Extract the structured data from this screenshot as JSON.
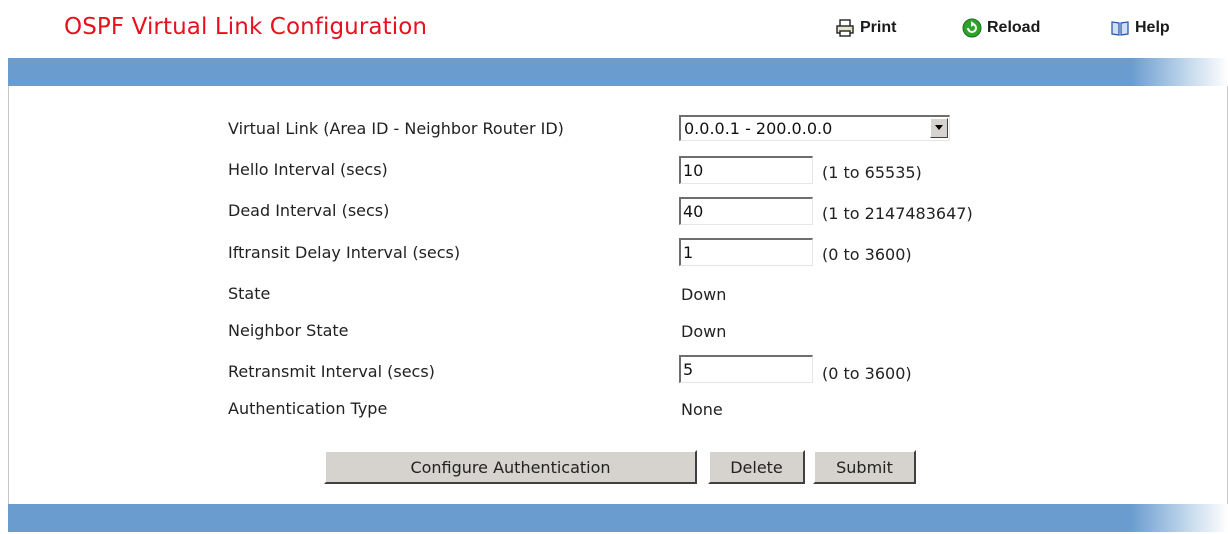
{
  "page": {
    "title": "OSPF Virtual Link Configuration"
  },
  "toolbar": {
    "print": "Print",
    "reload": "Reload",
    "help": "Help"
  },
  "colors": {
    "title": "#e8101f",
    "band": "#6a9ccf"
  },
  "form": {
    "virtual_link": {
      "label": "Virtual Link (Area ID - Neighbor Router ID)",
      "selected": "0.0.0.1 - 200.0.0.0"
    },
    "hello_interval": {
      "label": "Hello Interval (secs)",
      "value": "10",
      "range": "(1 to 65535)"
    },
    "dead_interval": {
      "label": "Dead Interval (secs)",
      "value": "40",
      "range": "(1 to 2147483647)"
    },
    "iftransit_delay": {
      "label": "Iftransit Delay Interval (secs)",
      "value": "1",
      "range": "(0 to 3600)"
    },
    "state": {
      "label": "State",
      "value": "Down"
    },
    "neighbor_state": {
      "label": "Neighbor State",
      "value": "Down"
    },
    "retransmit_interval": {
      "label": "Retransmit Interval (secs)",
      "value": "5",
      "range": "(0 to 3600)"
    },
    "auth_type": {
      "label": "Authentication Type",
      "value": "None"
    }
  },
  "buttons": {
    "configure_auth": "Configure Authentication",
    "delete": "Delete",
    "submit": "Submit"
  }
}
